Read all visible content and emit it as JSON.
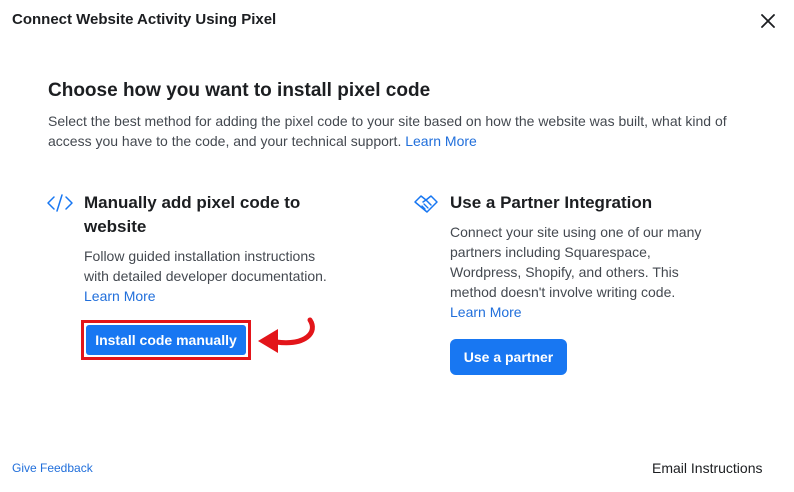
{
  "dialog": {
    "title": "Connect Website Activity Using Pixel",
    "close_icon": "close-icon"
  },
  "main": {
    "heading": "Choose how you want to install pixel code",
    "intro_text": "Select the best method for adding the pixel code to your site based on how the website was built, what kind of access you have to the code, and your technical support.",
    "intro_link": "Learn More"
  },
  "manual_option": {
    "icon": "code-icon",
    "title": "Manually add pixel code to website",
    "description": "Follow guided installation instructions with detailed developer documentation.",
    "link": "Learn More",
    "button_label": "Install code manually",
    "highlight_color": "#e3151a"
  },
  "partner_option": {
    "icon": "handshake-icon",
    "title": "Use a Partner Integration",
    "description": "Connect your site using one of our many partners including Squarespace, Wordpress, Shopify, and others. This method doesn't involve writing code.",
    "link": "Learn More",
    "button_label": "Use a partner"
  },
  "footer": {
    "feedback_link": "Give Feedback",
    "email_instructions": "Email Instructions"
  },
  "colors": {
    "accent": "#1877f2",
    "link": "#216fdb",
    "annotation": "#e3151a"
  }
}
